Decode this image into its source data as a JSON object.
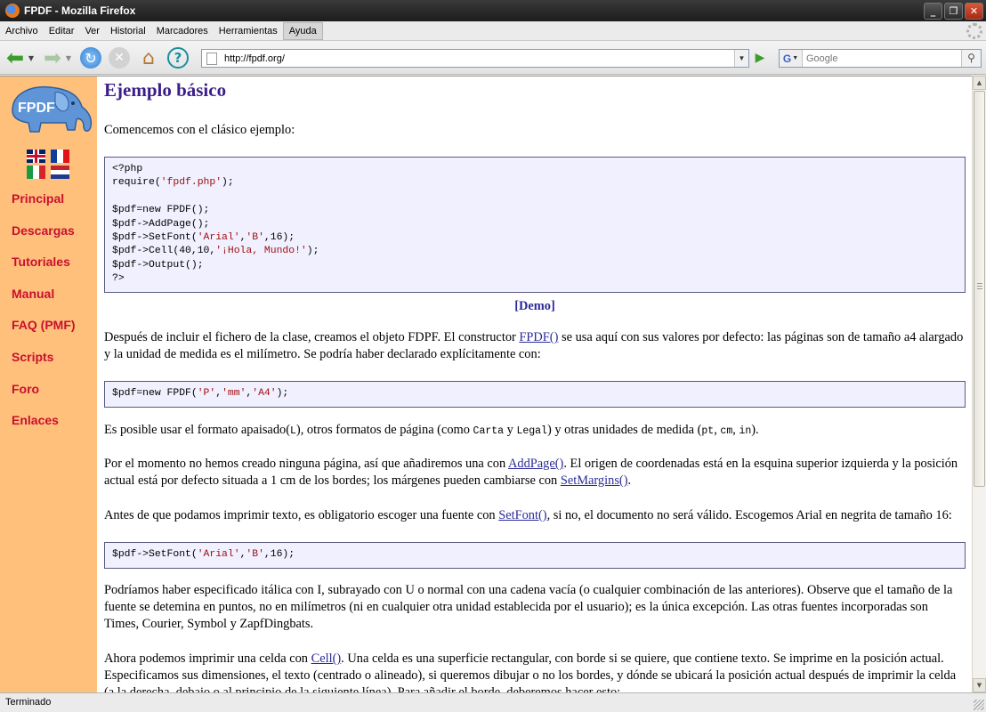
{
  "window": {
    "title": "FPDF - Mozilla Firefox"
  },
  "menu": [
    "Archivo",
    "Editar",
    "Ver",
    "Historial",
    "Marcadores",
    "Herramientas",
    "Ayuda"
  ],
  "toolbar": {
    "url": "http://fpdf.org/",
    "search_placeholder": "Google",
    "search_engine_letter": "G"
  },
  "sidebar": {
    "logo_text": "FPDF",
    "links": [
      "Principal",
      "Descargas",
      "Tutoriales",
      "Manual",
      "FAQ (PMF)",
      "Scripts",
      "Foro",
      "Enlaces"
    ]
  },
  "content": {
    "title": "Ejemplo básico",
    "intro": "Comencemos con el clásico ejemplo:",
    "code1_lines": [
      "<?php",
      "require('fpdf.php');",
      "",
      "$pdf=new FPDF();",
      "$pdf->AddPage();",
      "$pdf->SetFont('Arial','B',16);",
      "$pdf->Cell(40,10,'¡Hola, Mundo!');",
      "$pdf->Output();",
      "?>"
    ],
    "demo_label": "[Demo]",
    "p1_before": "Después de incluir el fichero de la clase, creamos el objeto FDPF. El constructor ",
    "p1_link": "FPDF()",
    "p1_after": " se usa aquí con sus valores por defecto: las páginas son de tamaño a4 alargado y la unidad de medida es el milímetro. Se podría haber declarado explícitamente con:",
    "code2": "$pdf=new FPDF('P','mm','A4');",
    "p2_a": "Es posible usar el formato apaisado(",
    "p2_code1": "L",
    "p2_b": "), otros formatos de página (como ",
    "p2_code2": "Carta",
    "p2_c": " y ",
    "p2_code3": "Legal",
    "p2_d": ") y otras unidades de medida (",
    "p2_code4": "pt",
    "p2_e": ", ",
    "p2_code5": "cm",
    "p2_f": ", ",
    "p2_code6": "in",
    "p2_g": ").",
    "p3_a": "Por el momento no hemos creado ninguna página, así que añadiremos una con ",
    "p3_link1": "AddPage()",
    "p3_b": ". El origen de coordenadas está en la esquina superior izquierda y la posición actual está por defecto situada a 1 cm de los bordes; los márgenes pueden cambiarse con ",
    "p3_link2": "SetMargins()",
    "p3_c": ".",
    "p4_a": "Antes de que podamos imprimir texto, es obligatorio escoger una fuente con ",
    "p4_link": "SetFont()",
    "p4_b": ", si no, el documento no será válido. Escogemos Arial en negrita de tamaño 16:",
    "code3": "$pdf->SetFont('Arial','B',16);",
    "p5": "Podríamos haber especificado itálica con I, subrayado con U o normal con una cadena vacía (o cualquier combinación de las anteriores). Observe que el tamaño de la fuente se detemina en puntos, no en milímetros (ni en cualquier otra unidad establecida por el usuario); es la única excepción. Las otras fuentes incorporadas son Times, Courier, Symbol y ZapfDingbats.",
    "p6_a": "Ahora podemos imprimir una celda con ",
    "p6_link": "Cell()",
    "p6_b": ". Una celda es una superficie rectangular, con borde si se quiere, que contiene texto. Se imprime en la posición actual. Especificamos sus dimensiones, el texto (centrado o alineado), si queremos dibujar o no los bordes, y dónde se ubicará la posición actual después de imprimir la celda (a la derecha, debajo o al principio de la siguiente línea). Para añadir el borde, deberemos hacer esto:"
  },
  "status": {
    "text": "Terminado"
  },
  "colors": {
    "sidebar_bg": "#ffc07c",
    "nav_link": "#c8102e",
    "heading": "#3c1d8a",
    "code_bg": "#f0f0ff"
  }
}
